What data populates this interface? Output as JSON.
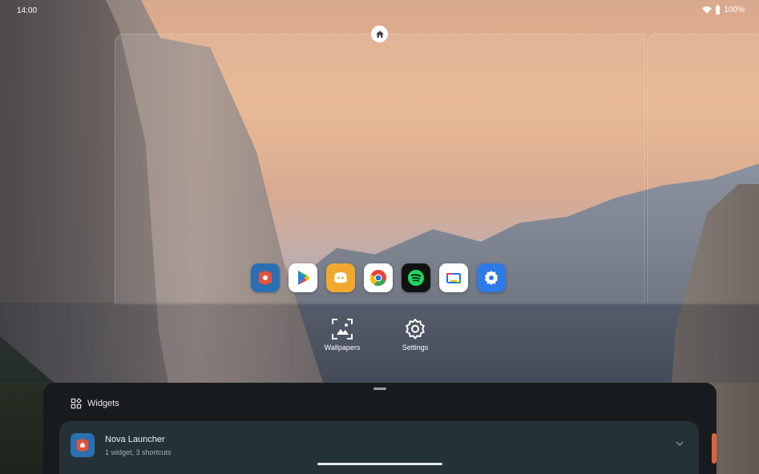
{
  "status_bar": {
    "time": "14:00",
    "battery_text": "100%"
  },
  "home_screen": {
    "home_indicator_icon": "home-icon",
    "dock_apps": [
      {
        "name": "Nova Launcher",
        "icon": "nova-launcher-icon"
      },
      {
        "name": "Google Play",
        "icon": "play-store-icon"
      },
      {
        "name": "Discord",
        "icon": "discord-icon"
      },
      {
        "name": "Chrome",
        "icon": "chrome-icon"
      },
      {
        "name": "Spotify",
        "icon": "spotify-icon"
      },
      {
        "name": "Google Meet",
        "icon": "meet-icon"
      },
      {
        "name": "Settings",
        "icon": "settings-app-icon"
      }
    ]
  },
  "options": {
    "wallpapers_label": "Wallpapers",
    "settings_label": "Settings"
  },
  "widgets_sheet": {
    "title": "Widgets",
    "apps": [
      {
        "name": "Nova Launcher",
        "summary": "1 widget, 3 shortcuts"
      }
    ]
  },
  "colors": {
    "sheet_bg": "#181b1d",
    "card_bg": "#243238",
    "scroll_accent": "#e2623b"
  }
}
